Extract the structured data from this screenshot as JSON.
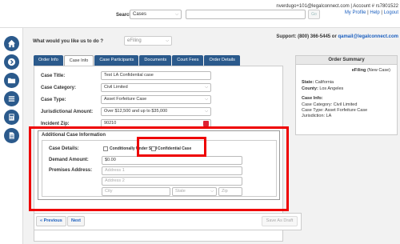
{
  "header": {
    "search_label": "Search:",
    "search_select": "Cases",
    "search_value": "",
    "go_label": "Go",
    "user_line": "nverdugo+101@legalconnect.com | Account # rs7801522",
    "links": {
      "profile": "My Profile",
      "help": "Help",
      "logout": "Logout"
    }
  },
  "leftnav": {
    "icons": [
      "home-icon",
      "arrow-right-icon",
      "folder-icon",
      "list-icon",
      "calculator-icon",
      "document-icon"
    ]
  },
  "main": {
    "question": "What would you like us to do ?",
    "efiling_select": "eFiling",
    "support_label": "Support: (800) 366-5445 or ",
    "support_email": "qamail@legalconnect.com"
  },
  "tabs": [
    {
      "label": "Order Info",
      "active": false
    },
    {
      "label": "Case Info",
      "active": true
    },
    {
      "label": "Case Participants",
      "active": false
    },
    {
      "label": "Documents",
      "active": false
    },
    {
      "label": "Court Fees",
      "active": false
    },
    {
      "label": "Order Details",
      "active": false
    }
  ],
  "form": {
    "case_title_label": "Case Title:",
    "case_title_value": "Test LA Confidential case",
    "case_category_label": "Case Category:",
    "case_category_value": "Civil Limited",
    "case_type_label": "Case Type:",
    "case_type_value": "Asset Forfeiture Case",
    "jurisdictional_label": "Jurisdictional Amount:",
    "jurisdictional_value": "Over $12,500 and up to $35,000",
    "zip_label": "Incident Zip:",
    "zip_value": "90210"
  },
  "additional": {
    "title": "Additional Case Information",
    "case_details_label": "Case Details:",
    "conditionally_under_seal": "Conditionally Under Seal",
    "confidential_case": "Confidential Case",
    "demand_label": "Demand Amount:",
    "demand_value": "$0.00",
    "premises_label": "Premises Address:",
    "address1_placeholder": "Address 1",
    "address2_placeholder": "Address 2",
    "city_placeholder": "City",
    "state_placeholder": "State",
    "zip_placeholder": "Zip"
  },
  "footer": {
    "previous": "« Previous",
    "next": "Next",
    "save_draft": "Save As Draft"
  },
  "summary": {
    "title": "Order Summary",
    "efiling": "eFiling",
    "efiling_note": "(New Case)",
    "state_label": "State:",
    "state_value": "California",
    "county_label": "County:",
    "county_value": "Los Angeles",
    "case_info_label": "Case Info:",
    "category_line": "Case Category: Civil Limited",
    "type_line": "Case Type: Asset Forfeiture Case",
    "jurisdiction_line": "Jurisdiction: LA"
  },
  "colors": {
    "nav_blue": "#2b5a8c",
    "highlight_red": "#e00000",
    "link_blue": "#1b5fbf"
  }
}
